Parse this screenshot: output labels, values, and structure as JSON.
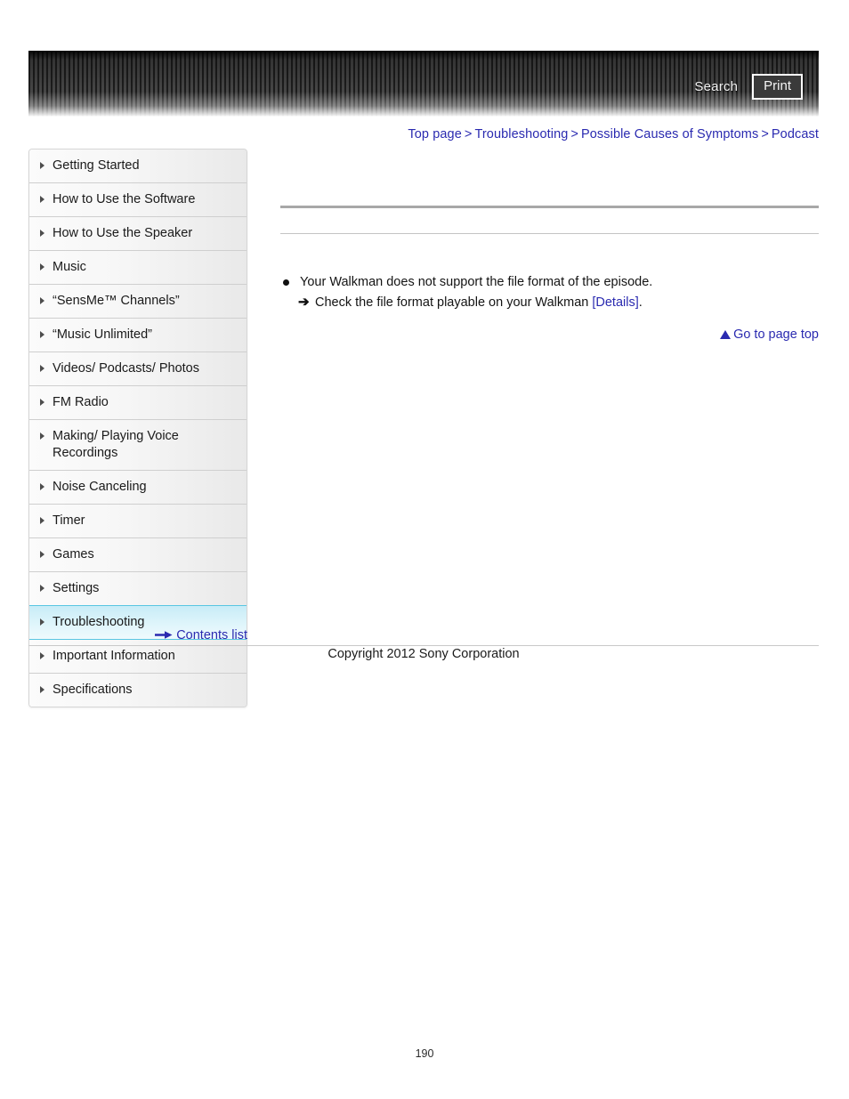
{
  "header": {
    "search_label": "Search",
    "print_label": "Print"
  },
  "breadcrumb": {
    "separator": ">",
    "items": [
      {
        "label": "Top page"
      },
      {
        "label": "Troubleshooting"
      },
      {
        "label": "Possible Causes of Symptoms"
      },
      {
        "label": "Podcast"
      }
    ]
  },
  "sidebar": {
    "items": [
      {
        "label": "Getting Started",
        "selected": false
      },
      {
        "label": "How to Use the Software",
        "selected": false
      },
      {
        "label": "How to Use the Speaker",
        "selected": false
      },
      {
        "label": "Music",
        "selected": false
      },
      {
        "label": "“SensMe™ Channels”",
        "selected": false
      },
      {
        "label": "“Music Unlimited”",
        "selected": false
      },
      {
        "label": "Videos/ Podcasts/ Photos",
        "selected": false
      },
      {
        "label": "FM Radio",
        "selected": false
      },
      {
        "label": "Making/ Playing Voice Recordings",
        "selected": false
      },
      {
        "label": "Noise Canceling",
        "selected": false
      },
      {
        "label": "Timer",
        "selected": false
      },
      {
        "label": "Games",
        "selected": false
      },
      {
        "label": "Settings",
        "selected": false
      },
      {
        "label": "Troubleshooting",
        "selected": true
      },
      {
        "label": "Important Information",
        "selected": false
      },
      {
        "label": "Specifications",
        "selected": false
      }
    ],
    "contents_list_label": "Contents list"
  },
  "main": {
    "cause_text": "Your Walkman does not support the file format of the episode.",
    "remedy_arrow": "➔",
    "remedy_text_before": "Check the file format playable on your Walkman ",
    "remedy_link_label": "[Details]",
    "remedy_text_after": ".",
    "go_to_page_top_label": "Go to page top"
  },
  "footer": {
    "copyright": "Copyright 2012 Sony Corporation",
    "page_number": "190"
  },
  "colors": {
    "link": "#2a2ab0",
    "selected_nav_border": "#58c6e2",
    "rule_thick": "#a8a8a8",
    "rule_thin": "#c4c4c4"
  }
}
